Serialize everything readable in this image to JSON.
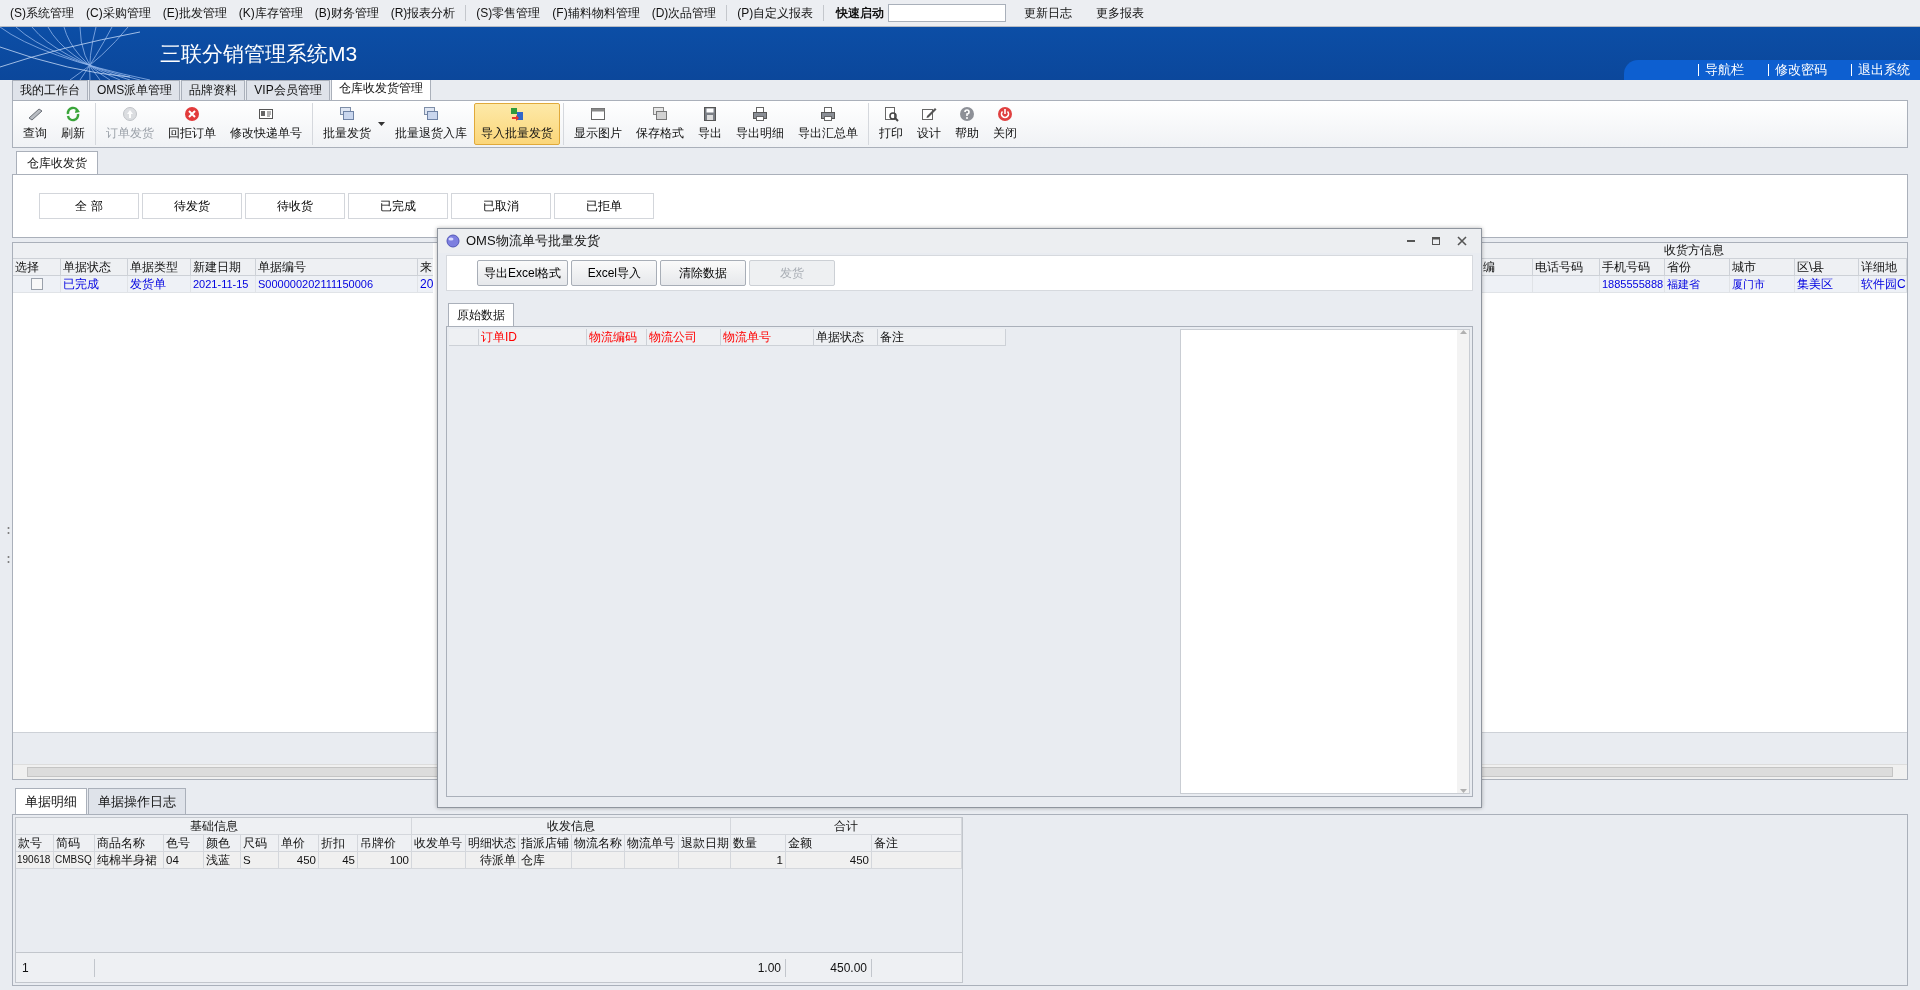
{
  "menu_bar": {
    "groups": [
      {
        "items": [
          "(S)系统管理",
          "(C)采购管理",
          "(E)批发管理",
          "(K)库存管理",
          "(B)财务管理",
          "(R)报表分析"
        ]
      },
      {
        "items": [
          "(S)零售管理",
          "(F)辅料物料管理",
          "(D)次品管理"
        ]
      },
      {
        "items": [
          "(P)自定义报表"
        ]
      }
    ],
    "quick_launch": {
      "label": "快速启动"
    },
    "links": [
      "更新日志",
      "更多报表"
    ]
  },
  "app": {
    "title": "三联分销管理系统M3",
    "links": [
      "导航栏",
      "修改密码",
      "退出系统"
    ]
  },
  "tabs": [
    {
      "label": "我的工作台",
      "selected": false
    },
    {
      "label": "OMS派单管理",
      "selected": false
    },
    {
      "label": "品牌资料",
      "selected": false
    },
    {
      "label": "VIP会员管理",
      "selected": false
    },
    {
      "label": "仓库收发货管理",
      "selected": true
    }
  ],
  "toolbar": {
    "groups": [
      {
        "buttons": [
          {
            "label": "查询",
            "disabled": false,
            "highlighted": false,
            "dropdown": false
          },
          {
            "label": "刷新",
            "disabled": false,
            "highlighted": false,
            "dropdown": false
          }
        ]
      },
      {
        "buttons": [
          {
            "label": "订单发货",
            "disabled": true,
            "highlighted": false,
            "dropdown": false
          },
          {
            "label": "回拒订单",
            "disabled": false,
            "highlighted": false,
            "dropdown": false
          },
          {
            "label": "修改快递单号",
            "disabled": false,
            "highlighted": false,
            "dropdown": false
          }
        ]
      },
      {
        "buttons": [
          {
            "label": "批量发货",
            "disabled": false,
            "highlighted": false,
            "dropdown": true
          },
          {
            "label": "批量退货入库",
            "disabled": false,
            "highlighted": false,
            "dropdown": false
          },
          {
            "label": "导入批量发货",
            "disabled": false,
            "highlighted": true,
            "dropdown": false
          }
        ]
      },
      {
        "buttons": [
          {
            "label": "显示图片",
            "disabled": false,
            "highlighted": false,
            "dropdown": false
          },
          {
            "label": "保存格式",
            "disabled": false,
            "highlighted": false,
            "dropdown": false
          },
          {
            "label": "导出",
            "disabled": false,
            "highlighted": false,
            "dropdown": false
          },
          {
            "label": "导出明细",
            "disabled": false,
            "highlighted": false,
            "dropdown": false
          },
          {
            "label": "导出汇总单",
            "disabled": false,
            "highlighted": false,
            "dropdown": false
          }
        ]
      },
      {
        "buttons": [
          {
            "label": "打印",
            "disabled": false,
            "highlighted": false,
            "dropdown": false
          },
          {
            "label": "设计",
            "disabled": false,
            "highlighted": false,
            "dropdown": false
          },
          {
            "label": "帮助",
            "disabled": false,
            "highlighted": false,
            "dropdown": false
          },
          {
            "label": "关闭",
            "disabled": false,
            "highlighted": false,
            "dropdown": false
          }
        ]
      }
    ]
  },
  "page_tabs": [
    {
      "label": "仓库收发货",
      "selected": true
    }
  ],
  "filters": [
    "全 部",
    "待发货",
    "待收货",
    "已完成",
    "已取消",
    "已拒单"
  ],
  "main_grid": {
    "rows": [
      {
        "checked": false
      }
    ],
    "columns_left": [
      {
        "header": "选择"
      },
      {
        "header": "单据状态",
        "cells": [
          "已完成"
        ]
      },
      {
        "header": "单据类型",
        "cells": [
          "发货单"
        ]
      },
      {
        "header": "新建日期",
        "cells": [
          "2021-11-15"
        ]
      },
      {
        "header": "单据编号",
        "cells": [
          "S000000202111150006"
        ]
      },
      {
        "header": "来",
        "cells": [
          "20"
        ]
      }
    ],
    "group_header": "收货方信息",
    "columns_right": [
      {
        "header": "编"
      },
      {
        "header": "电话号码"
      },
      {
        "header": "手机号码",
        "cells": [
          "1885555888"
        ]
      },
      {
        "header": "省份",
        "cells": [
          "福建省"
        ]
      },
      {
        "header": "城市",
        "cells": [
          "厦门市"
        ]
      },
      {
        "header": "区\\县",
        "cells": [
          "集美区"
        ]
      },
      {
        "header": "详细地",
        "cells": [
          "软件园C"
        ]
      }
    ]
  },
  "detail_tabs": [
    {
      "label": "单据明细",
      "selected": true
    },
    {
      "label": "单据操作日志",
      "selected": false
    }
  ],
  "detail_grid": {
    "row_count": "1",
    "groups": [
      {
        "label": "基础信息",
        "columns": [
          {
            "header": "款号",
            "numeric": false,
            "cells": [
              "190618"
            ]
          },
          {
            "header": "简码",
            "numeric": false,
            "cells": [
              "CMBSQ"
            ]
          },
          {
            "header": "商品名称",
            "numeric": false,
            "cells": [
              "纯棉半身裙"
            ]
          },
          {
            "header": "色号",
            "numeric": false,
            "cells": [
              "04"
            ]
          },
          {
            "header": "颜色",
            "numeric": false,
            "cells": [
              "浅蓝"
            ]
          },
          {
            "header": "尺码",
            "numeric": false,
            "cells": [
              "S"
            ]
          },
          {
            "header": "单价",
            "numeric": true,
            "cells": [
              "450"
            ]
          },
          {
            "header": "折扣",
            "numeric": true,
            "cells": [
              "45"
            ]
          },
          {
            "header": "吊牌价",
            "numeric": true,
            "cells": [
              "100"
            ]
          }
        ]
      },
      {
        "label": "收发信息",
        "columns": [
          {
            "header": "收发单号"
          },
          {
            "header": "明细状态",
            "numeric": true,
            "cells": [
              "待派单"
            ]
          },
          {
            "header": "指派店铺",
            "numeric": false,
            "cells": [
              "仓库"
            ]
          },
          {
            "header": "物流名称"
          },
          {
            "header": "物流单号"
          },
          {
            "header": "退款日期"
          }
        ]
      },
      {
        "label": "合计",
        "columns": [
          {
            "header": "数量",
            "numeric": true,
            "cells": [
              "1"
            ],
            "total": "1.00"
          },
          {
            "header": "金额",
            "numeric": true,
            "cells": [
              "450"
            ],
            "total": "450.00"
          },
          {
            "header": "备注"
          }
        ]
      }
    ]
  },
  "dialog": {
    "title": "OMS物流单号批量发货",
    "buttons": [
      {
        "label": "导出Excel格式",
        "disabled": false
      },
      {
        "label": "Excel导入",
        "disabled": false
      },
      {
        "label": "清除数据",
        "disabled": false
      },
      {
        "label": "发货",
        "disabled": true
      }
    ],
    "tabs": [
      {
        "label": "原始数据",
        "selected": true
      }
    ],
    "columns": [
      {
        "header": "订单ID",
        "required": true
      },
      {
        "header": "物流编码",
        "required": true
      },
      {
        "header": "物流公司",
        "required": true
      },
      {
        "header": "物流单号",
        "required": true
      },
      {
        "header": "单据状态",
        "required": false
      },
      {
        "header": "备注",
        "required": false
      }
    ]
  }
}
